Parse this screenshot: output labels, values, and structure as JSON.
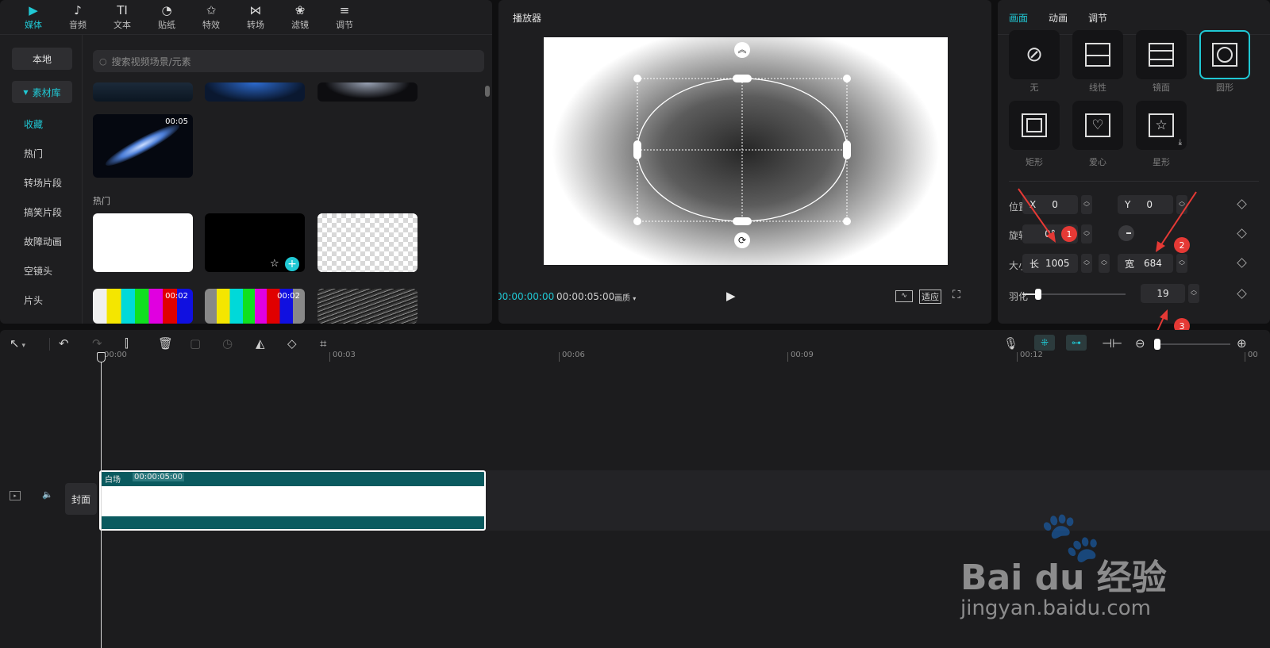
{
  "media": {
    "tabs": [
      {
        "label": "媒体",
        "icon": "media-icon",
        "glyph": "▶"
      },
      {
        "label": "音频",
        "icon": "audio-icon",
        "glyph": "♪"
      },
      {
        "label": "文本",
        "icon": "text-icon",
        "glyph": "TI"
      },
      {
        "label": "贴纸",
        "icon": "sticker-icon",
        "glyph": "◔"
      },
      {
        "label": "特效",
        "icon": "effects-icon",
        "glyph": "✩"
      },
      {
        "label": "转场",
        "icon": "transition-icon",
        "glyph": "⋈"
      },
      {
        "label": "滤镜",
        "icon": "filter-icon",
        "glyph": "❀"
      },
      {
        "label": "调节",
        "icon": "adjust-icon",
        "glyph": "≡"
      }
    ],
    "sidebar": {
      "local_label": "本地",
      "library_label": "素材库",
      "items": [
        "收藏",
        "热门",
        "转场片段",
        "搞笑片段",
        "故障动画",
        "空镜头",
        "片头"
      ]
    },
    "search_placeholder": "搜索视频场景/元素",
    "favorite_duration": "00:05",
    "section_hot": "热门",
    "thumb_durations": [
      "00:02",
      "00:02"
    ]
  },
  "player": {
    "title": "播放器",
    "current_time": "00:00:00:00",
    "total_time": "00:00:05:00",
    "quality_label": "画质",
    "fit_label": "适应"
  },
  "props": {
    "tabs": [
      "画面",
      "动画",
      "调节"
    ],
    "masks": [
      "无",
      "线性",
      "镜面",
      "圆形",
      "矩形",
      "爱心",
      "星形"
    ],
    "position_label": "位置",
    "x_label": "X",
    "x_value": "0",
    "y_label": "Y",
    "y_value": "0",
    "rotation_label": "旋转",
    "rotation_value": "0°",
    "size_label": "大小",
    "length_label": "长",
    "length_value": "1005",
    "width_label": "宽",
    "width_value": "684",
    "feather_label": "羽化",
    "feather_value": "19",
    "feather_level": 0.15
  },
  "timeline": {
    "ticks": [
      "00:00",
      "00:03",
      "00:06",
      "00:09",
      "00:12",
      "00"
    ],
    "cover_label": "封面",
    "clip_name": "白场",
    "clip_duration": "00:00:05:00"
  },
  "annotations": [
    "1",
    "2",
    "3"
  ],
  "watermark": {
    "brand": "Bai du 经验",
    "url": "jingyan.baidu.com"
  },
  "colors": {
    "accent": "#20c8d4",
    "clip": "#0a5a5f",
    "annotation": "#e53935"
  }
}
